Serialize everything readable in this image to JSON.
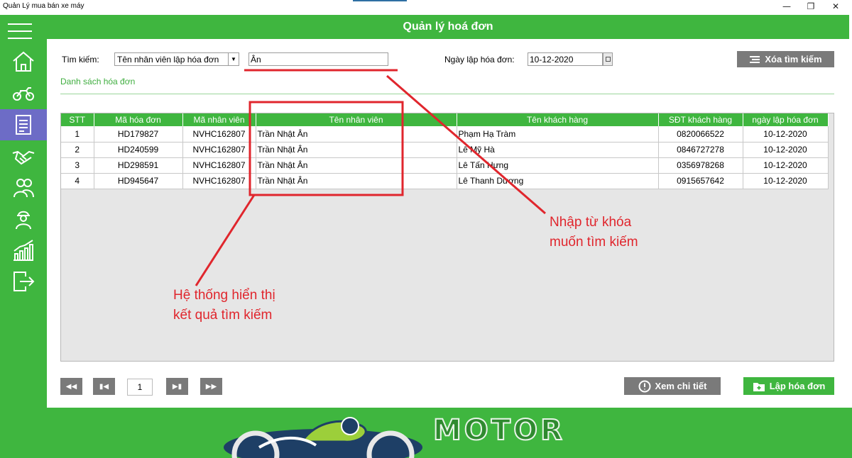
{
  "window": {
    "title": "Quản Lý mua bán xe máy",
    "minimize_icon": "minimize-icon",
    "restore_icon": "restore-icon",
    "close_icon": "close-icon"
  },
  "sidebar": {
    "items": [
      {
        "name": "home",
        "icon": "home-icon"
      },
      {
        "name": "motorbikes",
        "icon": "motorbike-icon"
      },
      {
        "name": "invoices",
        "icon": "invoice-icon",
        "active": true
      },
      {
        "name": "customers",
        "icon": "handshake-icon"
      },
      {
        "name": "employees",
        "icon": "users-icon"
      },
      {
        "name": "staff",
        "icon": "worker-icon"
      },
      {
        "name": "statistics",
        "icon": "chart-icon"
      },
      {
        "name": "logout",
        "icon": "logout-icon"
      }
    ],
    "active_color": "#6d6cc6"
  },
  "header": {
    "title": "Quản lý hoá đơn"
  },
  "search": {
    "label": "Tìm kiếm:",
    "field_selected": "Tên nhân viên lập hóa đơn",
    "keyword": "Ân",
    "date_label": "Ngày lập hóa đơn:",
    "date_value": "10-12-2020",
    "clear_label": "Xóa tìm kiếm"
  },
  "list": {
    "title": "Danh sách hóa đơn",
    "columns": [
      "STT",
      "Mã hóa đơn",
      "Mã nhân viên",
      "Tên nhân viên",
      "Tên khách hàng",
      "SĐT khách hàng",
      "ngày lập hóa đơn"
    ],
    "rows": [
      [
        "1",
        "HD179827",
        "NVHC162807",
        "Trần Nhật Ân",
        "Phạm Hạ Tràm",
        "0820066522",
        "10-12-2020"
      ],
      [
        "2",
        "HD240599",
        "NVHC162807",
        "Trần Nhật Ân",
        "Lê Mỹ Hà",
        "0846727278",
        "10-12-2020"
      ],
      [
        "3",
        "HD298591",
        "NVHC162807",
        "Trần Nhật Ân",
        "Lê Tấn Hưng",
        "0356978268",
        "10-12-2020"
      ],
      [
        "4",
        "HD945647",
        "NVHC162807",
        "Trần Nhật Ân",
        "Lê Thanh Dương",
        "0915657642",
        "10-12-2020"
      ]
    ]
  },
  "pager": {
    "page": "1"
  },
  "actions": {
    "detail_label": "Xem chi tiết",
    "create_label": "Lập hóa đơn"
  },
  "footer": {
    "logo_text": "MOTOR"
  },
  "annotations": {
    "keyword_note_line1": "Nhập từ khóa",
    "keyword_note_line2": "muốn tìm kiếm",
    "result_note_line1": "Hệ thống hiển thị",
    "result_note_line2": "kết quả tìm kiếm",
    "color": "#e0262d"
  },
  "colors": {
    "primary": "#3fb63f",
    "button_gray": "#7a7a7a"
  }
}
